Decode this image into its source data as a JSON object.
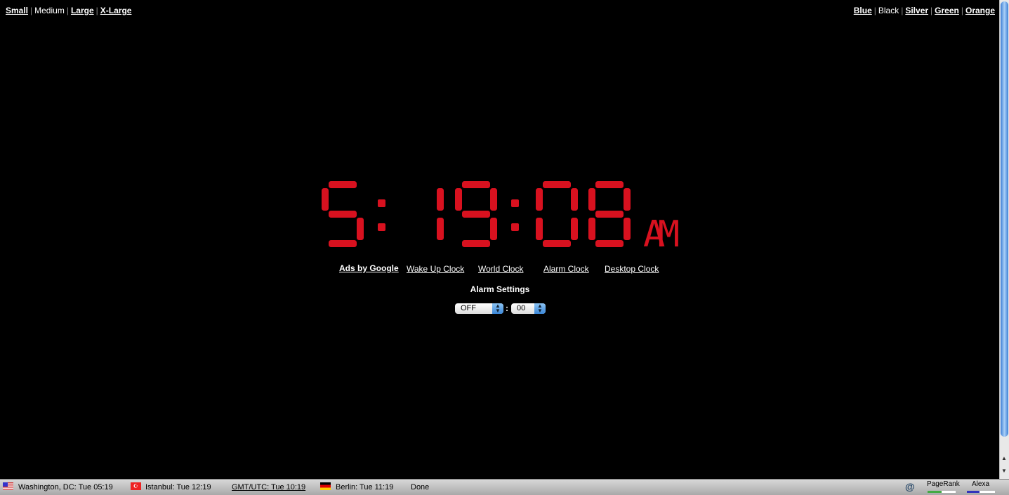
{
  "sizes": [
    "Small",
    "Medium",
    "Large",
    "X-Large"
  ],
  "sizes_active": "Medium",
  "colors": [
    "Blue",
    "Black",
    "Silver",
    "Green",
    "Orange"
  ],
  "colors_active": "Black",
  "clock": {
    "hours": "5",
    "minutes": "19",
    "seconds": "08",
    "ampm": "AM",
    "color": "#d8111f"
  },
  "links": {
    "ads": "Ads by Google",
    "wake": "Wake Up Clock",
    "world": "World Clock",
    "alarm": "Alarm Clock",
    "desktop": "Desktop Clock"
  },
  "alarm": {
    "title": "Alarm Settings",
    "hour": "OFF",
    "sep": ":",
    "minute": "00"
  },
  "status": {
    "washington": "Washington, DC: Tue 05:19",
    "istanbul": "Istanbul: Tue 12:19",
    "gmt": "GMT/UTC: Tue 10:19",
    "berlin": "Berlin: Tue 11:19",
    "done": "Done",
    "pagerank": "PageRank",
    "alexa": "Alexa",
    "pagerank_level": 0.5,
    "alexa_level": 0.45
  }
}
